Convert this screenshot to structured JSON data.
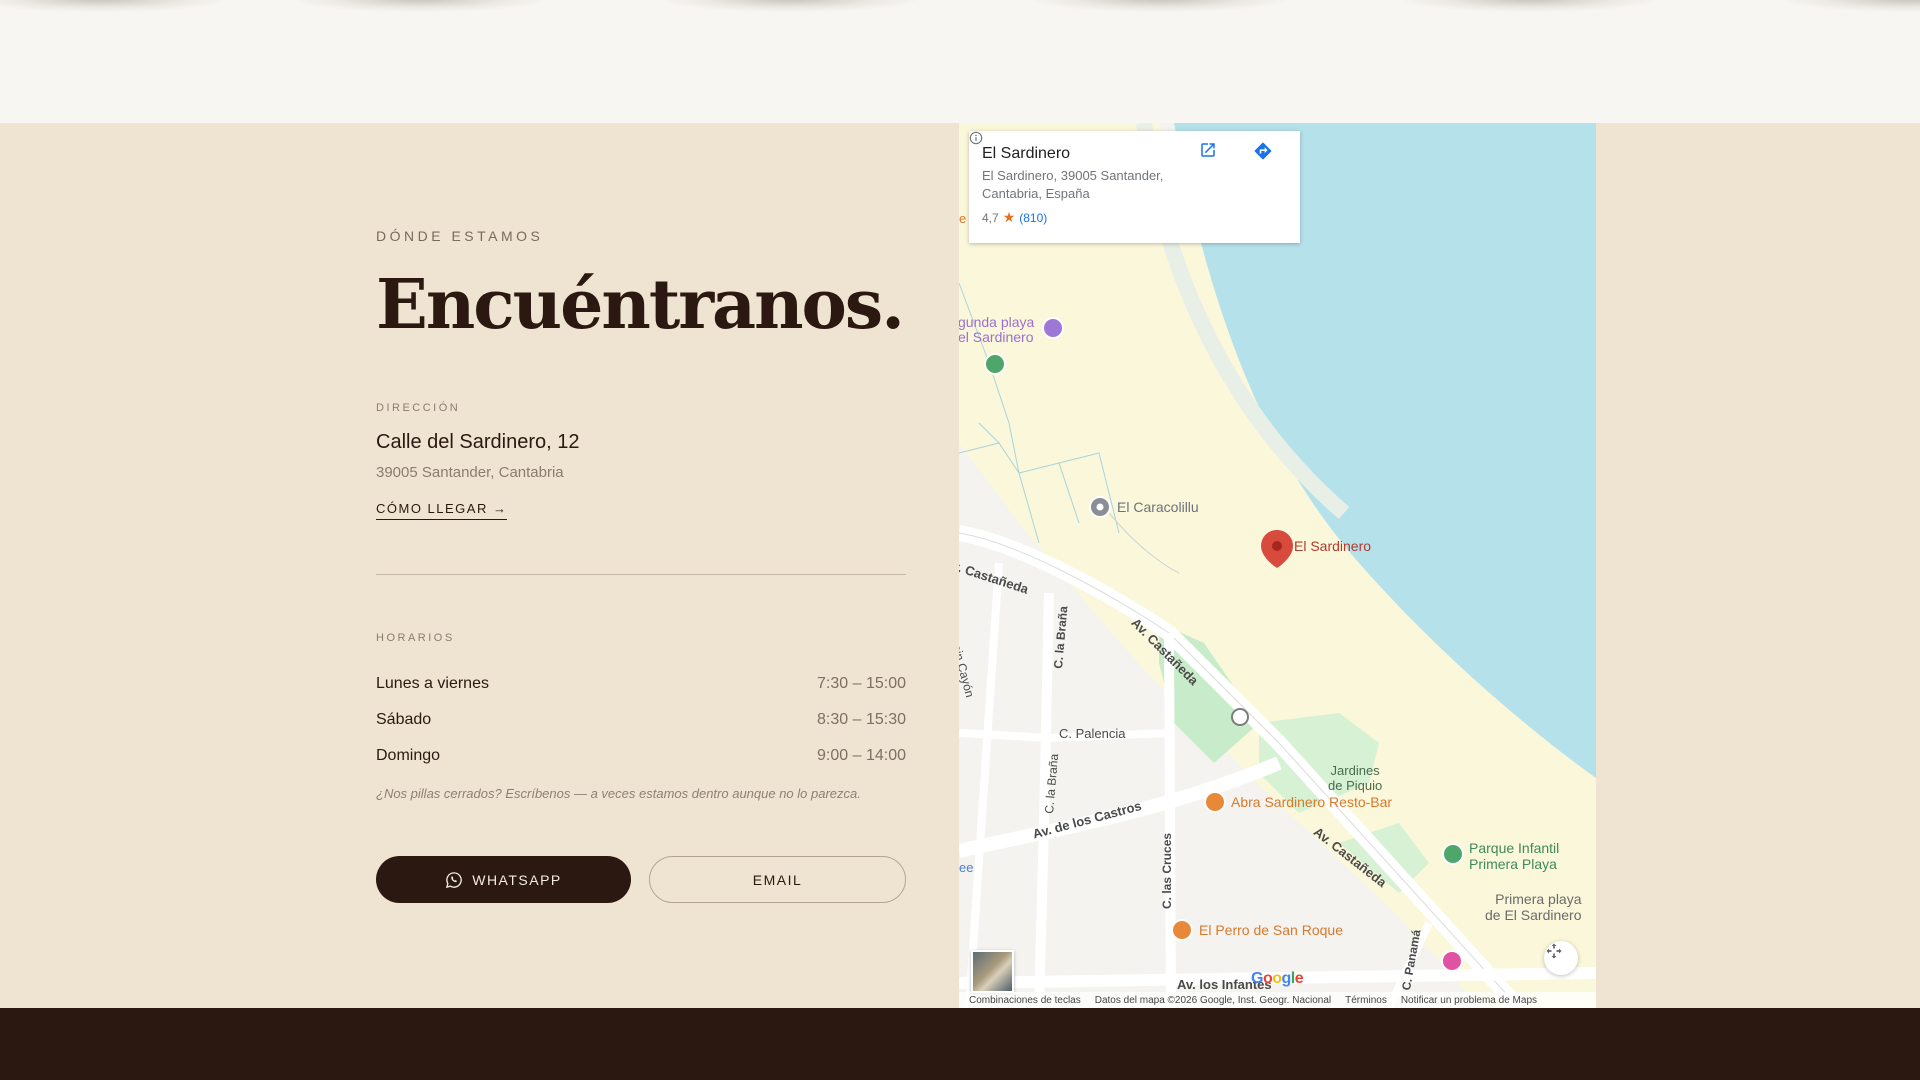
{
  "section": {
    "eyebrow": "DÓNDE ESTAMOS",
    "heading": "Encuéntranos.",
    "address": {
      "label": "DIRECCIÓN",
      "line1": "Calle del Sardinero, 12",
      "line2": "39005 Santander, Cantabria",
      "link": "CÓMO LLEGAR →"
    },
    "hours": {
      "label": "HORARIOS",
      "rows": [
        {
          "day": "Lunes a viernes",
          "time": "7:30 – 15:00"
        },
        {
          "day": "Sábado",
          "time": "8:30 – 15:30"
        },
        {
          "day": "Domingo",
          "time": "9:00 – 14:00"
        }
      ],
      "note": "¿Nos pillas cerrados? Escríbenos — a veces estamos dentro aunque no lo parezca."
    },
    "buttons": {
      "whatsapp": "WHATSAPP",
      "email": "EMAIL"
    }
  },
  "map": {
    "card": {
      "title": "El Sardinero",
      "address": "El Sardinero, 39005 Santander, Cantabria, España",
      "rating": "4,7",
      "reviews": "(810)"
    },
    "labels": {
      "segunda_playa": "gunda playa\nel Sardinero",
      "caracolillu": "El Caracolillu",
      "sardinero": "El Sardinero",
      "castaneda_1": "v. Castañeda",
      "castaneda_2": "Av. Castañeda",
      "castaneda_3": "Av. Castañeda",
      "la_brana_1": "C. la Braña",
      "la_brana_2": "C. la Braña",
      "palencia": "C. Palencia",
      "castros": "Av. de los Castros",
      "cruces": "C. las Cruces",
      "jardines": "Jardines\nde Piquio",
      "abra": "Abra Sardinero Resto-Bar",
      "parque": "Parque Infantil\nPrimera Playa",
      "primera_playa": "Primera playa\nde El Sardinero",
      "perro": "El Perro de San Roque",
      "infantes": "Av. los Infantes",
      "panama": "C. Panamá",
      "cayon": "ain Cayón",
      "edge_e": "e",
      "edge_ee": "ee"
    },
    "google": "Google",
    "footer": {
      "shortcuts": "Combinaciones de teclas",
      "data": "Datos del mapa ©2026 Google, Inst. Geogr. Nacional",
      "terms": "Términos",
      "report": "Notificar un problema de Maps"
    }
  }
}
